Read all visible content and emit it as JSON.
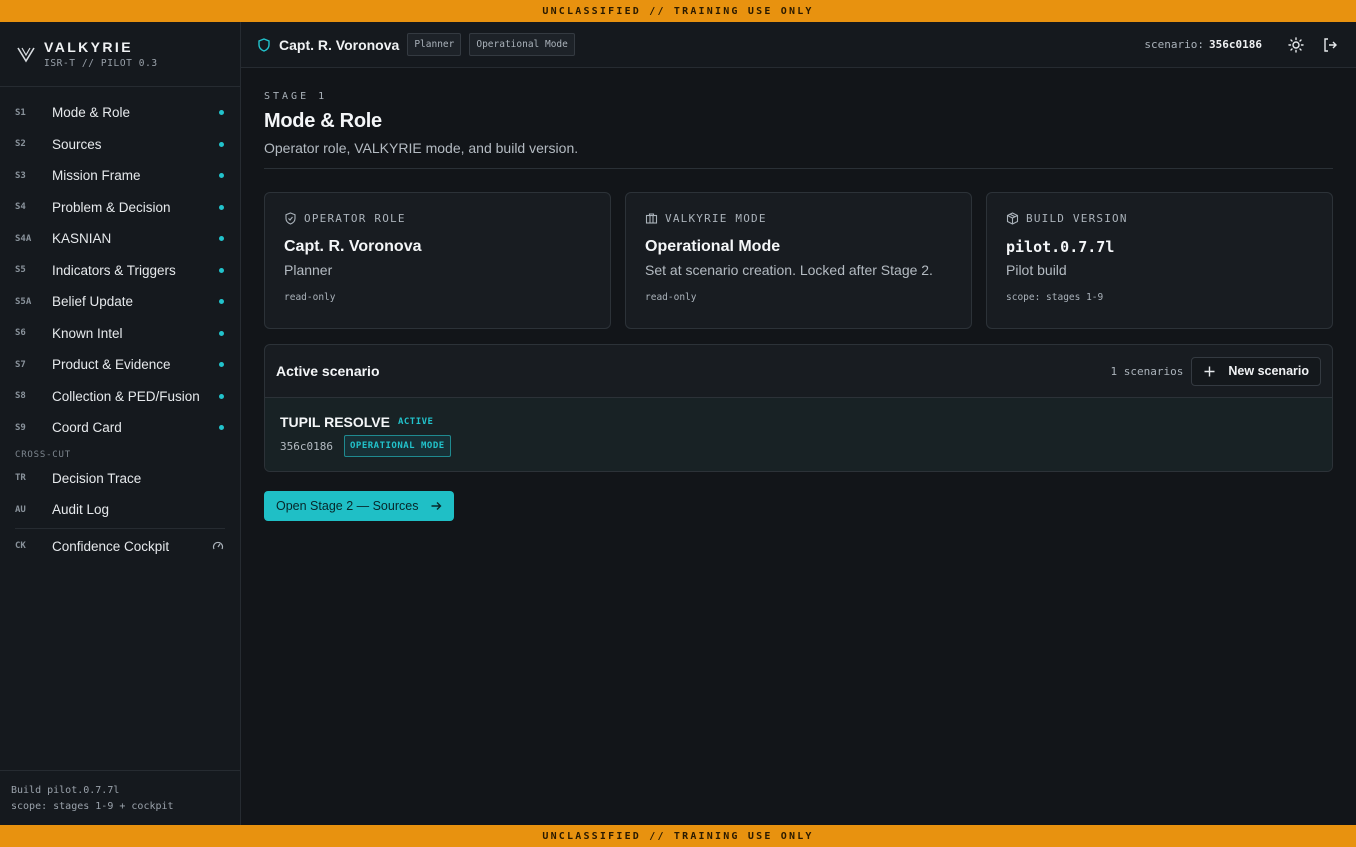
{
  "banner": {
    "text": "UNCLASSIFIED // TRAINING USE ONLY"
  },
  "brand": {
    "name": "VALKYRIE",
    "sub": "ISR-T // PILOT 0.3"
  },
  "nav": {
    "stages": [
      {
        "code": "S1",
        "label": "Mode & Role"
      },
      {
        "code": "S2",
        "label": "Sources"
      },
      {
        "code": "S3",
        "label": "Mission Frame"
      },
      {
        "code": "S4",
        "label": "Problem & Decision"
      },
      {
        "code": "S4A",
        "label": "KASNIAN"
      },
      {
        "code": "S5",
        "label": "Indicators & Triggers"
      },
      {
        "code": "S5A",
        "label": "Belief Update"
      },
      {
        "code": "S6",
        "label": "Known Intel"
      },
      {
        "code": "S7",
        "label": "Product & Evidence"
      },
      {
        "code": "S8",
        "label": "Collection & PED/Fusion"
      },
      {
        "code": "S9",
        "label": "Coord Card"
      }
    ],
    "crosscut_label": "CROSS-CUT",
    "crosscut": [
      {
        "code": "TR",
        "label": "Decision Trace"
      },
      {
        "code": "AU",
        "label": "Audit Log"
      }
    ],
    "cockpit": {
      "code": "CK",
      "label": "Confidence Cockpit"
    }
  },
  "sidebar_footer": {
    "build": "Build pilot.0.7.7l",
    "scope": "scope: stages 1-9 + cockpit"
  },
  "header": {
    "operator": "Capt. R. Voronova",
    "role_chip": "Planner",
    "mode_chip": "Operational Mode",
    "scenario_label": "scenario:",
    "scenario_id": "356c0186"
  },
  "main": {
    "kicker": "STAGE 1",
    "title": "Mode & Role",
    "subtitle": "Operator role, VALKYRIE mode, and build version."
  },
  "cards": {
    "role": {
      "kicker": "OPERATOR ROLE",
      "title": "Capt. R. Voronova",
      "sub": "Planner",
      "meta": "read-only"
    },
    "mode": {
      "kicker": "VALKYRIE MODE",
      "title": "Operational Mode",
      "sub": "Set at scenario creation. Locked after Stage 2.",
      "meta": "read-only"
    },
    "build": {
      "kicker": "BUILD VERSION",
      "title": "pilot.0.7.7l",
      "sub": "Pilot build",
      "meta": "scope: stages 1-9"
    }
  },
  "scenario_panel": {
    "title": "Active scenario",
    "count": "1 scenarios",
    "new_button": "New scenario",
    "row": {
      "name": "TUPIL RESOLVE",
      "status": "ACTIVE",
      "id": "356c0186",
      "mode": "OPERATIONAL MODE"
    }
  },
  "open_button": "Open Stage 2 — Sources",
  "colors": {
    "accent": "#22c3cc",
    "banner": "#e8920f",
    "background": "#121519"
  }
}
